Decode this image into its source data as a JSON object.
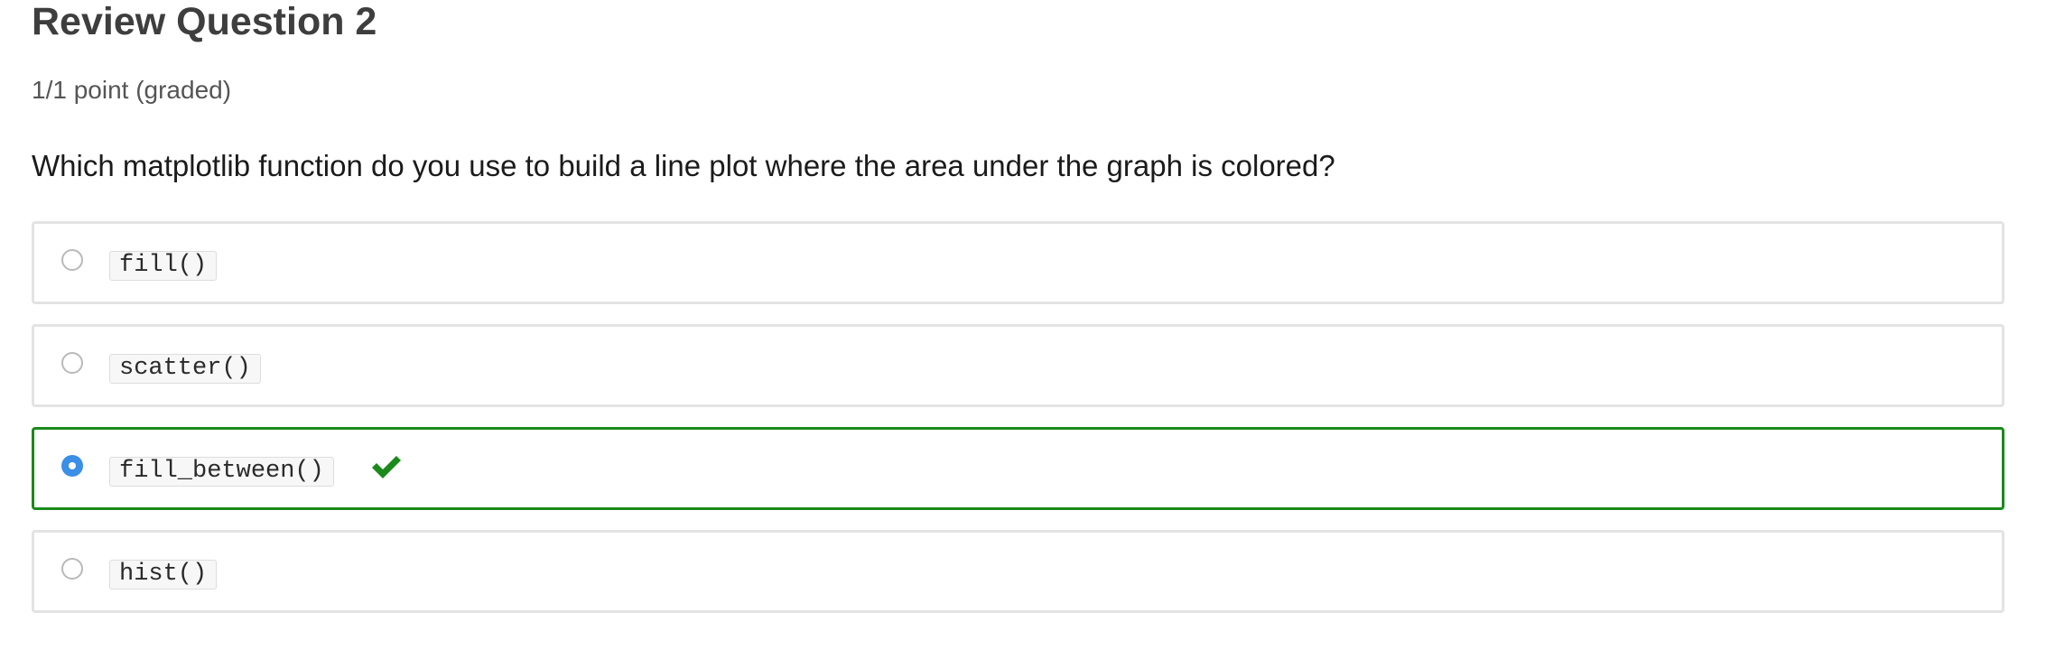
{
  "question": {
    "title": "Review Question 2",
    "points": "1/1 point (graded)",
    "prompt": "Which matplotlib function do you use to build a line plot where the area under the graph is colored?"
  },
  "choices": [
    {
      "label": "fill()",
      "selected": false,
      "correct": false
    },
    {
      "label": "scatter()",
      "selected": false,
      "correct": false
    },
    {
      "label": "fill_between()",
      "selected": true,
      "correct": true
    },
    {
      "label": "hist()",
      "selected": false,
      "correct": false
    }
  ],
  "colors": {
    "correct_border": "#1a8a1a",
    "radio_selected": "#3b8fe6",
    "checkmark": "#1a8a1a"
  },
  "icons": {
    "correct_mark": "checkmark-icon"
  }
}
